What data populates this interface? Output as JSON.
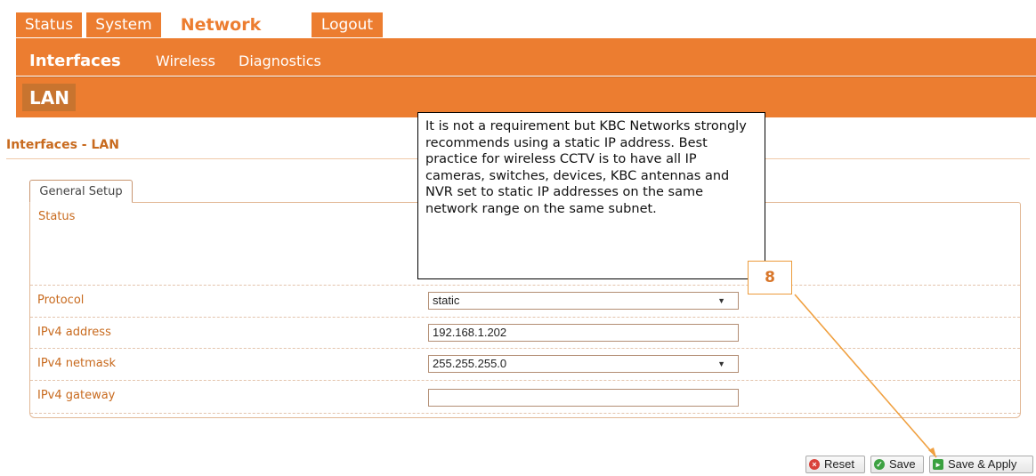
{
  "top_tabs": [
    {
      "label": "Status"
    },
    {
      "label": "System"
    },
    {
      "label": "Network"
    },
    {
      "label": "Logout"
    }
  ],
  "subnav": [
    {
      "label": "Interfaces"
    },
    {
      "label": "Wireless"
    },
    {
      "label": "Diagnostics"
    }
  ],
  "page_header": "LAN",
  "section_title": "Interfaces - LAN",
  "tab_general_setup": "General Setup",
  "status_label": "Status",
  "form": {
    "protocol": {
      "label": "Protocol",
      "value": "static"
    },
    "ipv4_address": {
      "label": "IPv4 address",
      "value": "192.168.1.202"
    },
    "ipv4_netmask": {
      "label": "IPv4 netmask",
      "value": "255.255.255.0"
    },
    "ipv4_gateway": {
      "label": "IPv4 gateway",
      "value": ""
    }
  },
  "buttons": {
    "reset": "Reset",
    "save": "Save",
    "save_apply": "Save & Apply"
  },
  "callout": {
    "text": "It is not a requirement but KBC Networks strongly recommends using a static IP address. Best practice for wireless CCTV is to have all IP cameras, switches, devices, KBC antennas and NVR set to static IP addresses on the same network range on the same subnet.",
    "step_number": "8"
  },
  "colors": {
    "accent": "#ec7d30",
    "label": "#c86a1e",
    "annotation_arrow": "#f0a040"
  }
}
